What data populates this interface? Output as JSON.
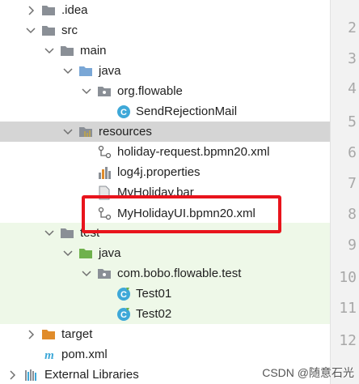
{
  "colors": {
    "folder": "#8a8f96",
    "source_folder": "#7aa7d6",
    "resources_folder": "#b8a255",
    "test_folder": "#6fb14d",
    "target_folder": "#e08c2b",
    "class_icon": "#3ea8d8",
    "selection": "#d5d5d5",
    "highlight_box": "#e8141c"
  },
  "tree": {
    "idea": ".idea",
    "src": "src",
    "main": "main",
    "main_java": "java",
    "pkg_main": "org.flowable",
    "class_send": "SendRejectionMail",
    "resources": "resources",
    "file_holiday": "holiday-request.bpmn20.xml",
    "file_log4j": "log4j.properties",
    "file_bar": "MyHoliday.bar",
    "file_ui": "MyHolidayUI.bpmn20.xml",
    "test": "test",
    "test_java": "java",
    "pkg_test": "com.bobo.flowable.test",
    "class_test01": "Test01",
    "class_test02": "Test02",
    "target": "target",
    "pom": "pom.xml",
    "ext_libs": "External Libraries"
  },
  "gutter": [
    "2",
    "3",
    "4",
    "5",
    "6",
    "7",
    "8",
    "9",
    "10",
    "11",
    "12"
  ],
  "watermark": "CSDN @随意石光"
}
